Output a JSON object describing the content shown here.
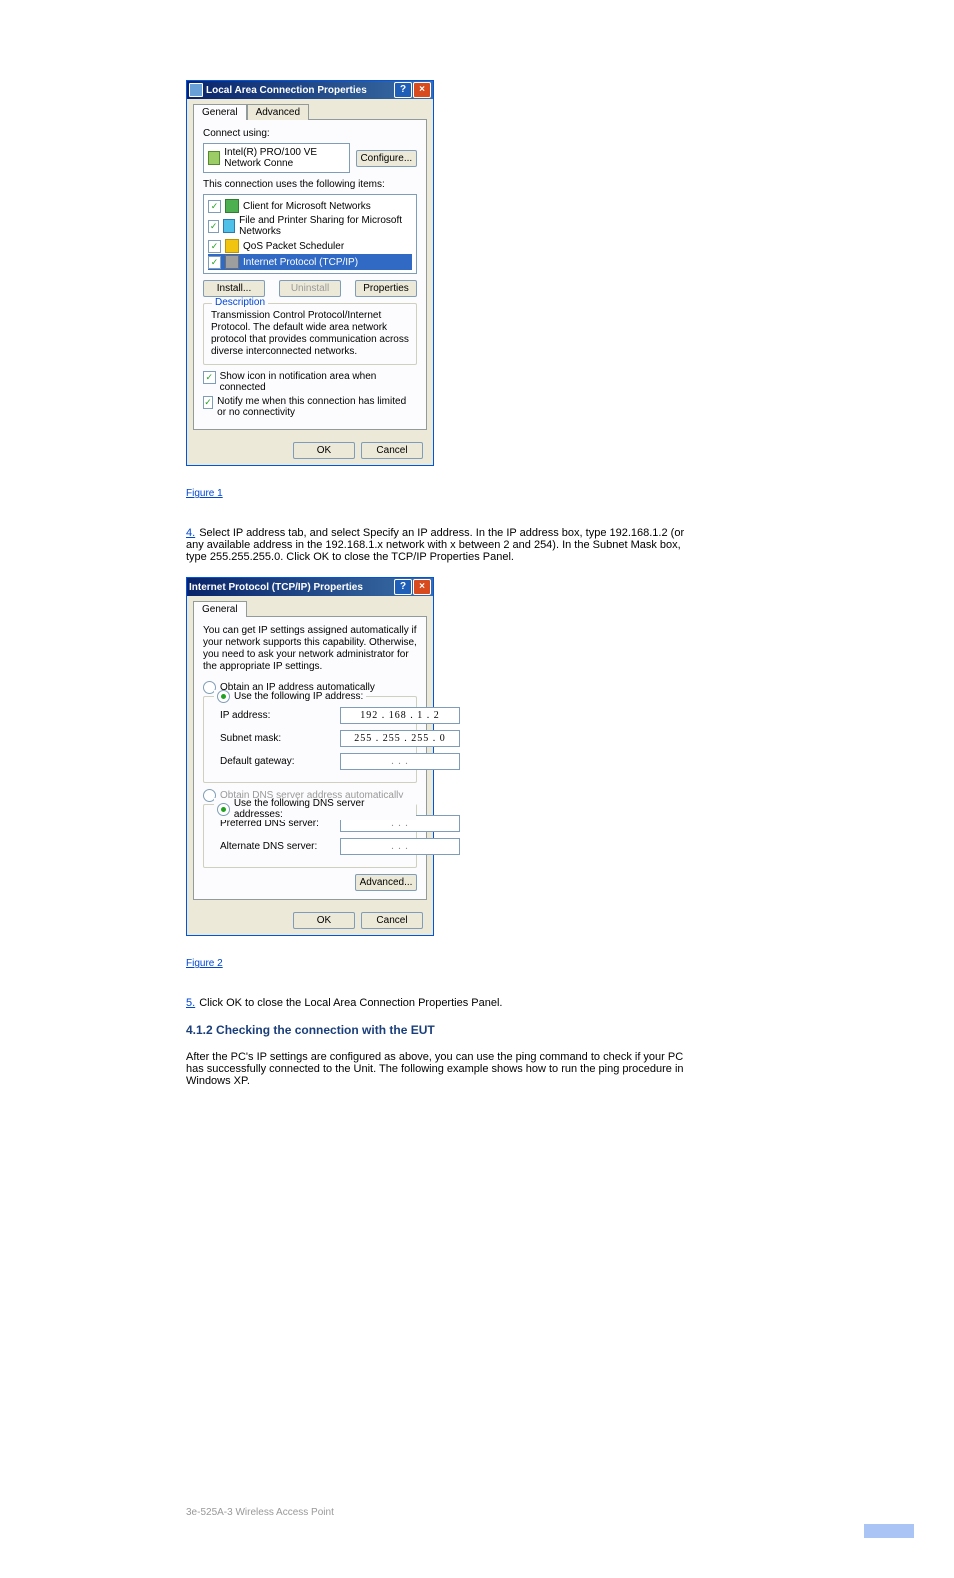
{
  "dialog1": {
    "title": "Local Area Connection Properties",
    "help": "?",
    "close": "×",
    "tabs": {
      "general": "General",
      "advanced": "Advanced"
    },
    "connect_using": "Connect using:",
    "nic": "Intel(R) PRO/100 VE Network Conne",
    "configure": "Configure...",
    "uses": "This connection uses the following items:",
    "items": [
      {
        "label": "Client for Microsoft Networks"
      },
      {
        "label": "File and Printer Sharing for Microsoft Networks"
      },
      {
        "label": "QoS Packet Scheduler"
      },
      {
        "label": "Internet Protocol (TCP/IP)"
      }
    ],
    "install": "Install...",
    "uninstall": "Uninstall",
    "properties": "Properties",
    "desc_title": "Description",
    "desc": "Transmission Control Protocol/Internet Protocol. The default wide area network protocol that provides communication across diverse interconnected networks.",
    "show": "Show icon in notification area when connected",
    "notify": "Notify me when this connection has limited or no connectivity",
    "ok": "OK",
    "cancel": "Cancel"
  },
  "fig1": "Figure 1",
  "step4": {
    "num": "4.",
    "text": "Select IP address tab, and select Specify an IP address. In the IP address box, type 192.168.1.2 (or any available address in the 192.168.1.x network with x between 2 and 254). In the Subnet Mask box, type 255.255.255.0. Click OK to close the TCP/IP Properties Panel."
  },
  "dialog2": {
    "title": "Internet Protocol (TCP/IP) Properties",
    "help": "?",
    "close": "×",
    "tab": "General",
    "intro": "You can get IP settings assigned automatically if your network supports this capability. Otherwise, you need to ask your network administrator for the appropriate IP settings.",
    "auto": "Obtain an IP address automatically",
    "use": "Use the following IP address:",
    "ip_lbl": "IP address:",
    "ip": "192 . 168 .  1  .  2",
    "mask_lbl": "Subnet mask:",
    "mask": "255 . 255 . 255 .  0",
    "gw_lbl": "Default gateway:",
    "gw": ".       .       .",
    "dnsauto": "Obtain DNS server address automatically",
    "usedns": "Use the following DNS server addresses:",
    "pref_lbl": "Preferred DNS server:",
    "pref": ".       .       .",
    "alt_lbl": "Alternate DNS server:",
    "alt": ".       .       .",
    "advanced": "Advanced...",
    "ok": "OK",
    "cancel": "Cancel"
  },
  "fig2": "Figure 2",
  "step5": {
    "num": "5.",
    "text": "Click OK to close the Local Area Connection Properties Panel."
  },
  "section": "4.1.2 Checking the connection with the EUT",
  "section_body": "After the PC's IP settings are configured as above, you can use the ping command to check if your PC has successfully connected to the Unit. The following example shows how to run the ping procedure in Windows XP.",
  "footer": "3e-525A-3 Wireless Access Point"
}
